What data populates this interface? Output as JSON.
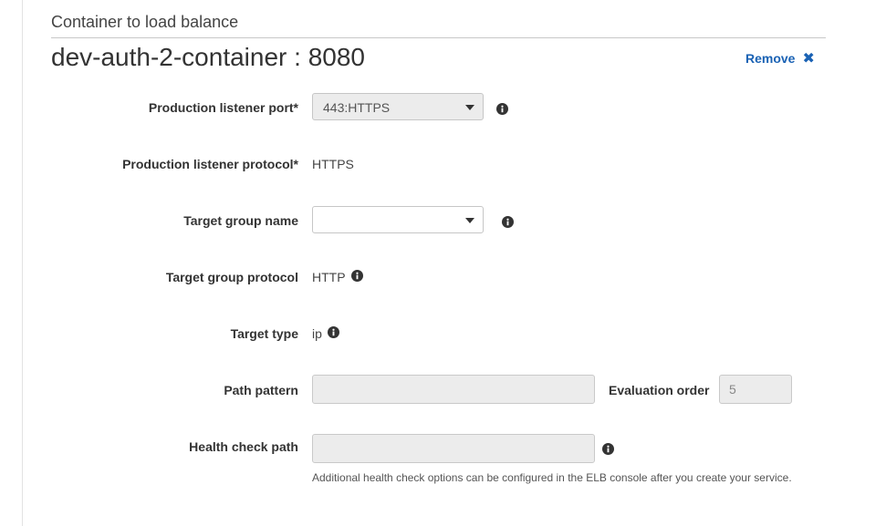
{
  "section": {
    "label": "Container to load balance",
    "container_title": "dev-auth-2-container : 8080",
    "remove_label": "Remove",
    "remove_icon": "✖"
  },
  "fields": {
    "listener_port": {
      "label": "Production listener port*",
      "value": "443:HTTPS"
    },
    "listener_protocol": {
      "label": "Production listener protocol*",
      "value": "HTTPS"
    },
    "target_group_name": {
      "label": "Target group name",
      "value": ""
    },
    "target_group_protocol": {
      "label": "Target group protocol",
      "value": "HTTP"
    },
    "target_type": {
      "label": "Target type",
      "value": "ip"
    },
    "path_pattern": {
      "label": "Path pattern",
      "value": ""
    },
    "evaluation_order": {
      "label": "Evaluation order",
      "value": "5"
    },
    "health_check_path": {
      "label": "Health check path",
      "value": "",
      "help": "Additional health check options can be configured in the ELB console after you create your service."
    }
  },
  "colors": {
    "link": "#1a62b4",
    "disabled_bg": "#ececec"
  },
  "icons": {
    "info": "info-circle-icon",
    "remove": "close-x-icon",
    "caret": "caret-down-icon"
  }
}
